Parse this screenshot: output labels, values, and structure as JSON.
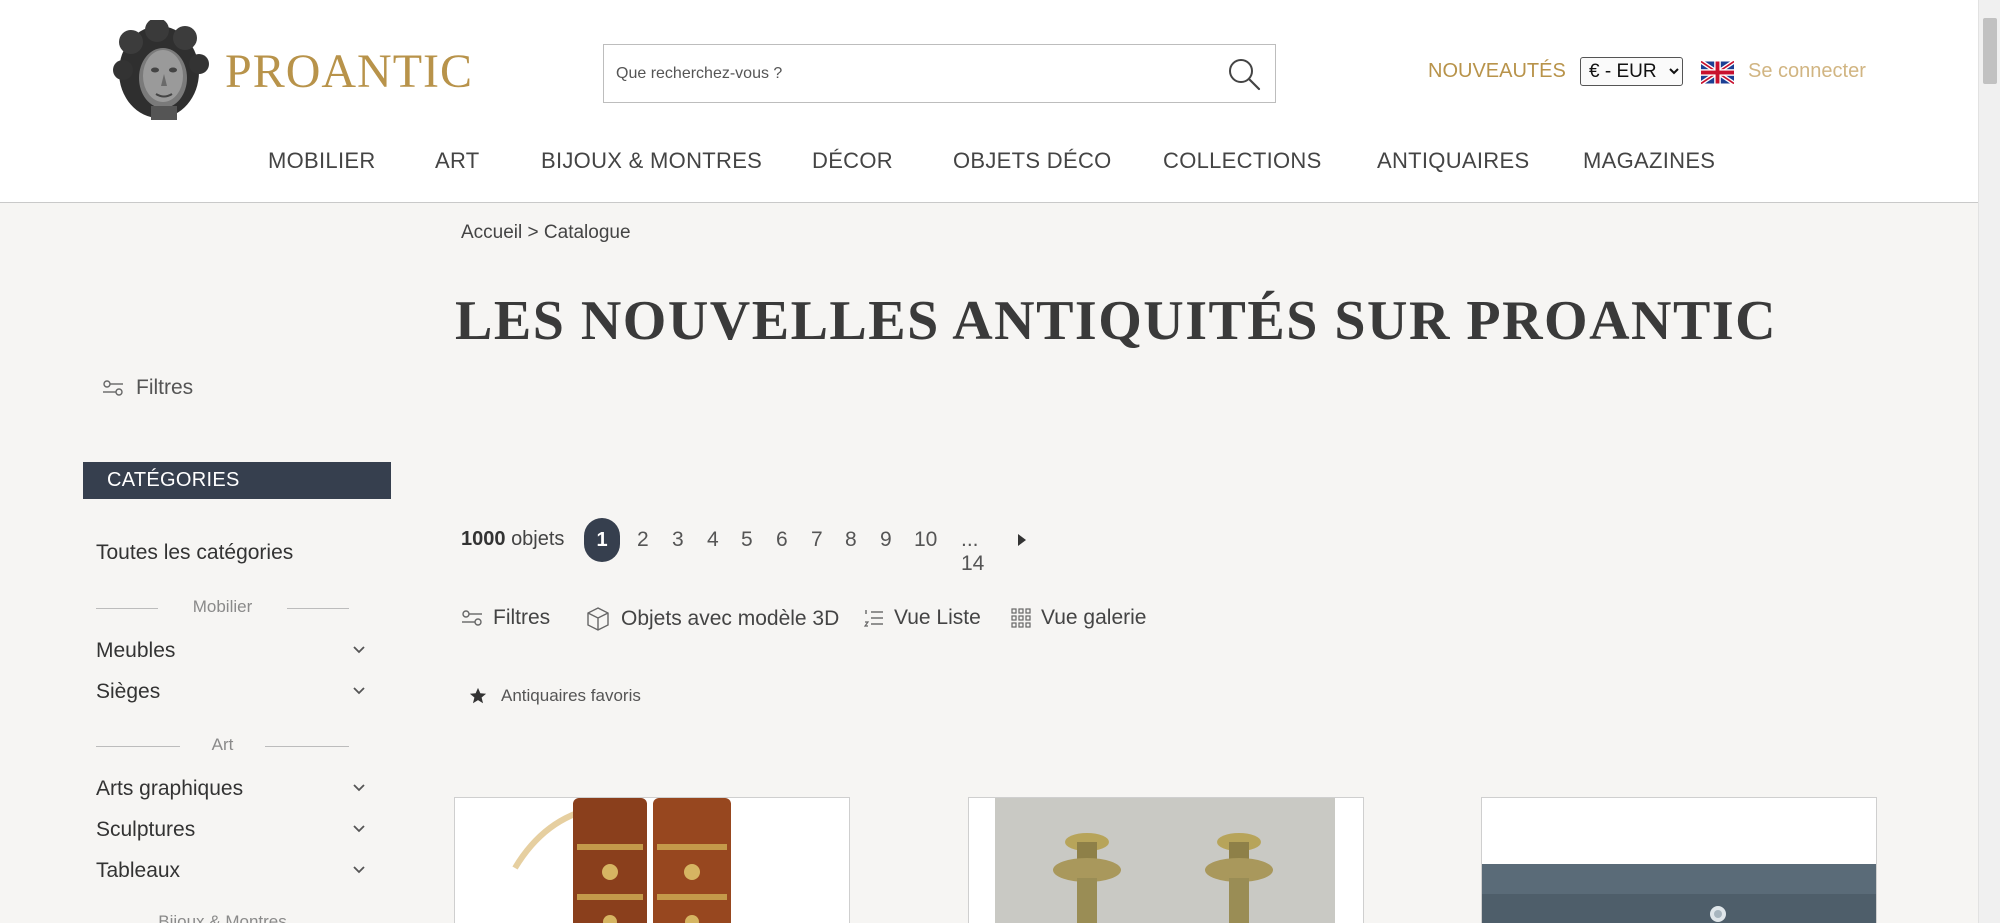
{
  "header": {
    "brand": "PROANTIC",
    "search_placeholder": "Que recherchez-vous ?",
    "new_label": "NOUVEAUTÉS",
    "currency": "€ - EUR",
    "login_label": "Se connecter",
    "accent_color": "#b8934a",
    "nav": [
      "MOBILIER",
      "ART",
      "BIJOUX & MONTRES",
      "DÉCOR",
      "OBJETS DÉCO",
      "COLLECTIONS",
      "ANTIQUAIRES",
      "MAGAZINES"
    ]
  },
  "breadcrumb": {
    "home": "Accueil",
    "separator": ">",
    "current": "Catalogue"
  },
  "title": "LES NOUVELLES ANTIQUITÉS SUR PROANTIC",
  "sidebar": {
    "filters_label": "Filtres",
    "categories_title": "CATÉGORIES",
    "all_categories": "Toutes les catégories",
    "groups": [
      {
        "label": "Mobilier",
        "items": [
          "Meubles",
          "Sièges"
        ]
      },
      {
        "label": "Art",
        "items": [
          "Arts graphiques",
          "Sculptures",
          "Tableaux"
        ]
      },
      {
        "label": "Bijoux & Montres",
        "items": []
      }
    ]
  },
  "results": {
    "count": "1000",
    "count_unit": "objets",
    "current_page": "1",
    "pages": [
      "2",
      "3",
      "4",
      "5",
      "6",
      "7",
      "8",
      "9",
      "10"
    ],
    "last_page": "... 14"
  },
  "toolbar": {
    "filters": "Filtres",
    "models3d": "Objets avec modèle 3D",
    "list_view": "Vue Liste",
    "gallery_view": "Vue galerie",
    "favorites": "Antiquaires favoris"
  },
  "icons": {
    "search": "search-icon",
    "flag": "uk-flag-icon",
    "filters": "sliders-icon",
    "models3d": "cube-icon",
    "list": "list-icon",
    "gallery": "grid-icon",
    "favorites": "star-icon",
    "next": "caret-right-icon"
  },
  "colors": {
    "dark": "#363f4e",
    "gold": "#b8934a",
    "background": "#f6f5f3"
  }
}
